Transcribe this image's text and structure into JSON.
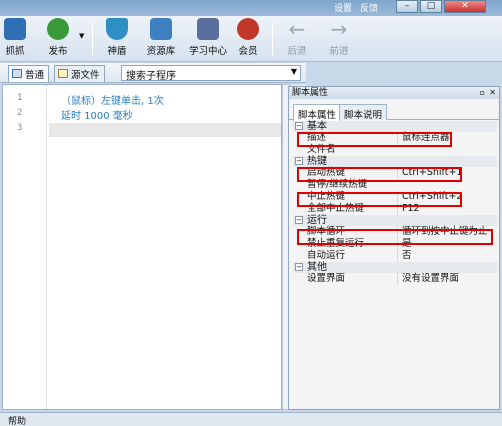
{
  "titlebar": {
    "link1": "设置",
    "link2": "反馈",
    "min": "–",
    "max": "□",
    "close": "✕"
  },
  "toolbar": {
    "items": [
      {
        "label": "抓抓",
        "icon": "grab-icon",
        "color": "#2f6fb5"
      },
      {
        "label": "发布",
        "icon": "publish-icon",
        "color": "#3a9a3a"
      },
      {
        "label": "神盾",
        "icon": "shield-icon",
        "color": "#2d8fc4"
      },
      {
        "label": "资源库",
        "icon": "resource-library-icon",
        "color": "#3d7fbf"
      },
      {
        "label": "学习中心",
        "icon": "learning-center-icon",
        "color": "#5a6fa0"
      },
      {
        "label": "会员",
        "icon": "member-icon",
        "color": "#c0392b"
      },
      {
        "label": "后退",
        "icon": "back-arrow-icon",
        "color": "#9aa9b8"
      },
      {
        "label": "前进",
        "icon": "forward-arrow-icon",
        "color": "#9aa9b8"
      }
    ],
    "publish_dropdown": "▼"
  },
  "editor_tabs": {
    "tab1": "普通",
    "tab2": "源文件",
    "subroutine_select": "搜索子程序"
  },
  "editor": {
    "line_numbers": [
      "1",
      "2",
      "3"
    ],
    "lines": [
      "（鼠标）左键单击, 1次",
      "延时 1000 毫秒",
      ""
    ]
  },
  "properties": {
    "title": "脚本属性",
    "tabs": [
      "脚本属性",
      "脚本说明"
    ],
    "categories": [
      {
        "name": "基本",
        "rows": [
          {
            "key": "描述",
            "value": "鼠标连点器"
          },
          {
            "key": "文件名",
            "value": ""
          }
        ]
      },
      {
        "name": "热键",
        "rows": [
          {
            "key": "启动热键",
            "value": "Ctrl+Shift+1"
          },
          {
            "key": "暂停/继续热键",
            "value": ""
          },
          {
            "key": "中止热键",
            "value": "Ctrl+Shift+2"
          },
          {
            "key": "全部中止热键",
            "value": "F12"
          }
        ]
      },
      {
        "name": "运行",
        "rows": [
          {
            "key": "脚本循环",
            "value": "循环到按中止键为止"
          },
          {
            "key": "禁止重复运行",
            "value": "是"
          },
          {
            "key": "自动运行",
            "value": "否"
          }
        ]
      },
      {
        "name": "其他",
        "rows": [
          {
            "key": "设置界面",
            "value": "没有设置界面"
          }
        ]
      }
    ]
  },
  "status": {
    "text": "帮助"
  },
  "colors": {
    "highlight": "#e00000",
    "code_text": "#2a7fc0"
  }
}
